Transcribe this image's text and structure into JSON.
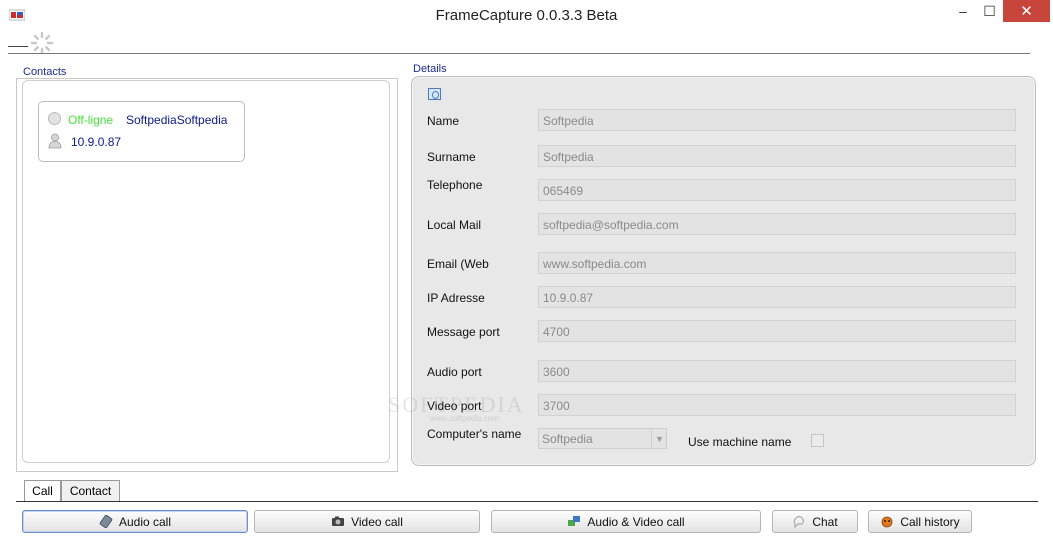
{
  "window": {
    "title": "FrameCapture 0.0.3.3 Beta",
    "controls": {
      "minimize": "–",
      "maximize": "☐",
      "close": "✕"
    }
  },
  "contacts": {
    "label": "Contacts",
    "items": [
      {
        "status": "Off-ligne",
        "name": "SoftpediaSoftpedia",
        "ip": "10.9.0.87"
      }
    ]
  },
  "details": {
    "label": "Details",
    "fields": {
      "name": {
        "label": "Name",
        "value": "Softpedia"
      },
      "surname": {
        "label": "Surname",
        "value": "Softpedia"
      },
      "telephone": {
        "label": "Telephone",
        "value": "065469"
      },
      "local_mail": {
        "label": "Local Mail",
        "value": "softpedia@softpedia.com"
      },
      "email_web": {
        "label": "Email (Web",
        "value": "www.softpedia.com"
      },
      "ip_address": {
        "label": "IP Adresse",
        "value": "10.9.0.87"
      },
      "message_port": {
        "label": "Message port",
        "value": "4700"
      },
      "audio_port": {
        "label": "Audio port",
        "value": "3600"
      },
      "video_port": {
        "label": "Video port",
        "value": "3700"
      }
    },
    "computer_name": {
      "label": "Computer's name",
      "selected": "Softpedia"
    },
    "use_machine_name": {
      "label": "Use machine name",
      "checked": false
    }
  },
  "tabs": [
    {
      "label": "Call",
      "active": true
    },
    {
      "label": "Contact",
      "active": false
    }
  ],
  "actions": {
    "audio_call": "Audio call",
    "video_call": "Video call",
    "audio_video_call": "Audio & Video call",
    "chat": "Chat",
    "call_history": "Call history"
  },
  "watermark": {
    "text": "SOFTPEDIA",
    "sub": "www.softpedia.com"
  },
  "colors": {
    "status_offline": "#48e03a",
    "contact_text": "#0c1a8a",
    "panel_label": "#1b2a8f",
    "close_button": "#c7453b"
  }
}
